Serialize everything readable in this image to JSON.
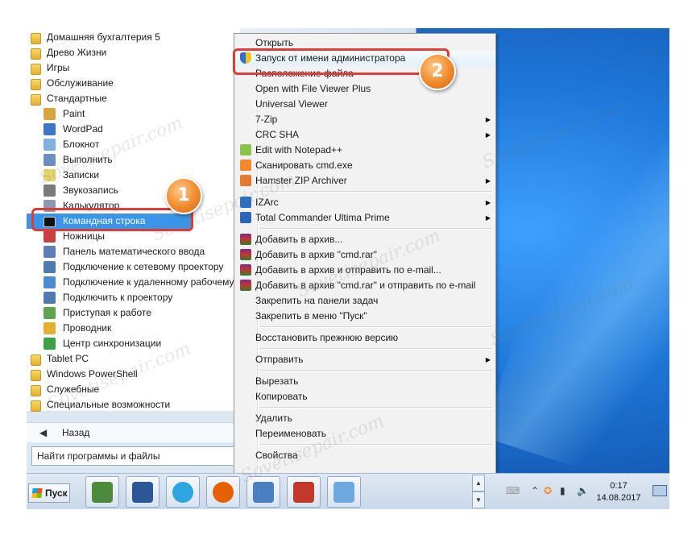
{
  "programs": [
    {
      "label": "Домашняя бухгалтерия 5",
      "icon": "folder-icon",
      "type": "folder",
      "color": "#e9b534"
    },
    {
      "label": "Древо Жизни",
      "icon": "folder-icon",
      "type": "folder",
      "color": "#e9b534"
    },
    {
      "label": "Игры",
      "icon": "folder-icon",
      "type": "folder",
      "color": "#e9b534"
    },
    {
      "label": "Обслуживание",
      "icon": "folder-icon",
      "type": "folder",
      "color": "#e9b534"
    },
    {
      "label": "Стандартные",
      "icon": "folder-open-icon",
      "type": "folder",
      "color": "#e9b534"
    },
    {
      "label": "Paint",
      "icon": "paint-icon",
      "type": "app",
      "color": "#d9a441"
    },
    {
      "label": "WordPad",
      "icon": "wordpad-icon",
      "type": "app",
      "color": "#3d76c7"
    },
    {
      "label": "Блокнот",
      "icon": "notepad-icon",
      "type": "app",
      "color": "#7fb0de"
    },
    {
      "label": "Выполнить",
      "icon": "run-icon",
      "type": "app",
      "color": "#6a8fc0"
    },
    {
      "label": "Записки",
      "icon": "sticky-notes-icon",
      "type": "app",
      "color": "#e6d66a"
    },
    {
      "label": "Звукозапись",
      "icon": "microphone-icon",
      "type": "app",
      "color": "#7a7a7a"
    },
    {
      "label": "Калькулятор",
      "icon": "calculator-icon",
      "type": "app",
      "color": "#8a9bb0"
    },
    {
      "label": "Командная строка",
      "icon": "command-prompt-icon",
      "type": "app",
      "color": "#111111",
      "selected": true
    },
    {
      "label": "Ножницы",
      "icon": "scissors-icon",
      "type": "app",
      "color": "#c94040"
    },
    {
      "label": "Панель математического ввода",
      "icon": "math-input-icon",
      "type": "app",
      "color": "#5a7fb8"
    },
    {
      "label": "Подключение к сетевому проектору",
      "icon": "network-projector-icon",
      "type": "app",
      "color": "#4f7ab3"
    },
    {
      "label": "Подключение к удаленному рабочему",
      "icon": "remote-desktop-icon",
      "type": "app",
      "color": "#4b8bd0"
    },
    {
      "label": "Подключить к проектору",
      "icon": "projector-icon",
      "type": "app",
      "color": "#4f7ab3"
    },
    {
      "label": "Приступая к работе",
      "icon": "getting-started-icon",
      "type": "app",
      "color": "#5fa24f"
    },
    {
      "label": "Проводник",
      "icon": "explorer-icon",
      "type": "app",
      "color": "#e3b12f"
    },
    {
      "label": "Центр синхронизации",
      "icon": "sync-center-icon",
      "type": "app",
      "color": "#3aa34a"
    },
    {
      "label": "Tablet PC",
      "icon": "folder-icon",
      "type": "folder",
      "color": "#e9b534"
    },
    {
      "label": "Windows PowerShell",
      "icon": "folder-icon",
      "type": "folder",
      "color": "#e9b534"
    },
    {
      "label": "Служебные",
      "icon": "folder-icon",
      "type": "folder",
      "color": "#e9b534"
    },
    {
      "label": "Специальные возможности",
      "icon": "folder-icon",
      "type": "folder",
      "color": "#e9b534"
    }
  ],
  "back_label": "Назад",
  "search_placeholder": "Найти программы и файлы",
  "start_label": "Пуск",
  "context_menu": [
    {
      "label": "Открыть",
      "icon": "",
      "submenu": false,
      "bold": true
    },
    {
      "label": "Запуск от имени администратора",
      "icon": "uac-shield-icon",
      "submenu": false,
      "highlight": true
    },
    {
      "label": "Расположение файла",
      "icon": "",
      "submenu": false
    },
    {
      "label": "Open with File Viewer Plus",
      "icon": "",
      "submenu": false
    },
    {
      "label": "Universal Viewer",
      "icon": "",
      "submenu": false
    },
    {
      "label": "7-Zip",
      "icon": "",
      "submenu": true
    },
    {
      "label": "CRC SHA",
      "icon": "",
      "submenu": true
    },
    {
      "label": "Edit with Notepad++",
      "icon": "notepadpp-icon",
      "submenu": false
    },
    {
      "label": "Сканировать cmd.exe",
      "icon": "avast-icon",
      "submenu": false
    },
    {
      "label": "Hamster ZIP Archiver",
      "icon": "hamster-icon",
      "submenu": true
    },
    {
      "sep": true
    },
    {
      "label": "IZArc",
      "icon": "izarc-icon",
      "submenu": true
    },
    {
      "label": "Total Commander Ultima Prime",
      "icon": "total-commander-icon",
      "submenu": true
    },
    {
      "sep": true
    },
    {
      "label": "Добавить в архив...",
      "icon": "winrar-icon",
      "submenu": false
    },
    {
      "label": "Добавить в архив \"cmd.rar\"",
      "icon": "winrar-icon",
      "submenu": false
    },
    {
      "label": "Добавить в архив и отправить по e-mail...",
      "icon": "winrar-icon",
      "submenu": false
    },
    {
      "label": "Добавить в архив \"cmd.rar\" и отправить по e-mail",
      "icon": "winrar-icon",
      "submenu": false
    },
    {
      "label": "Закрепить на панели задач",
      "icon": "",
      "submenu": false
    },
    {
      "label": "Закрепить в меню \"Пуск\"",
      "icon": "",
      "submenu": false
    },
    {
      "sep": true
    },
    {
      "label": "Восстановить прежнюю версию",
      "icon": "",
      "submenu": false
    },
    {
      "sep": true
    },
    {
      "label": "Отправить",
      "icon": "",
      "submenu": true
    },
    {
      "sep": true
    },
    {
      "label": "Вырезать",
      "icon": "",
      "submenu": false
    },
    {
      "label": "Копировать",
      "icon": "",
      "submenu": false
    },
    {
      "sep": true
    },
    {
      "label": "Удалить",
      "icon": "",
      "submenu": false
    },
    {
      "label": "Переименовать",
      "icon": "",
      "submenu": false
    },
    {
      "sep": true
    },
    {
      "label": "Свойства",
      "icon": "",
      "submenu": false
    }
  ],
  "taskbar_apps": [
    {
      "icon": "task-manager-icon",
      "color": "#4c8a3c"
    },
    {
      "icon": "word-icon",
      "color": "#2b5797"
    },
    {
      "icon": "telegram-icon",
      "color": "#2ca5e0"
    },
    {
      "icon": "firefox-icon",
      "color": "#e66000"
    },
    {
      "icon": "control-panel-icon",
      "color": "#4a7fc1"
    },
    {
      "icon": "toolbox-icon",
      "color": "#c0392b"
    },
    {
      "icon": "notepad-icon",
      "color": "#6fa8dc"
    }
  ],
  "tray": {
    "time": "0:17",
    "date": "14.08.2017"
  },
  "callouts": [
    {
      "number": "1"
    },
    {
      "number": "2"
    }
  ],
  "watermark": "Sovetisepair.com",
  "accent_color": "#e23a37",
  "badge_color": "#f08a2c"
}
